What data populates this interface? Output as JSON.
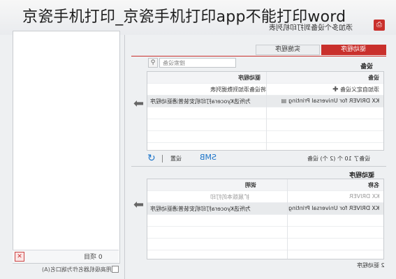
{
  "caption": "京瓷手机打印_京瓷手机打印app不能打印word",
  "window": {
    "title": "添加多个设备到打印机列表",
    "tabs": [
      "驱动程序",
      "实施程序"
    ],
    "active_tab": 0,
    "accent": "#c9302c"
  },
  "devices_section": {
    "label": "设备",
    "search_placeholder": "搜索设备",
    "columns": [
      "设备",
      "驱动程序"
    ],
    "rows": [
      {
        "device": "添加自定义设备",
        "driver": "将设备添加到数据列表"
      },
      {
        "device": "KX DRIVER for Universal Printing",
        "driver": "为所选Kyocera打印机安装普通驱动程序"
      }
    ],
    "toolbar": {
      "settings": "设置",
      "smb": "SMB",
      "count": "设备了 10 个 (2 个) 设备"
    }
  },
  "drivers_section": {
    "label": "驱动程序",
    "columns": [
      "名称",
      "说明"
    ],
    "rows": [
      {
        "name": "KX DRIVER",
        "desc": "扩展版本的打印"
      },
      {
        "name": "KX DRIVER for Universal Printing",
        "desc": "为所选Kyocera打印机安装普通驱动程序"
      }
    ],
    "count": "2 驱动程序"
  },
  "left_panel": {
    "count": "0 项目",
    "checkbox_label": "使用高级机器名作为端口名(A)"
  }
}
